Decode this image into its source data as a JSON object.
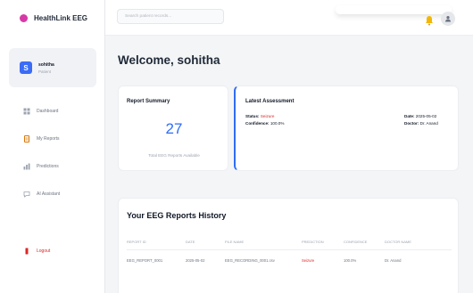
{
  "brand": {
    "name": "HealthLink EEG"
  },
  "user": {
    "initial": "S",
    "name": "sohitha",
    "role": "Patient"
  },
  "sidebar": {
    "items": [
      {
        "label": "Dashboard",
        "icon": "grid-icon"
      },
      {
        "label": "My Reports",
        "icon": "document-icon"
      },
      {
        "label": "Predictions",
        "icon": "chart-icon"
      },
      {
        "label": "AI Assistant",
        "icon": "chat-icon"
      }
    ],
    "logout_label": "Logout"
  },
  "topbar": {
    "search_placeholder": "Search patient records..."
  },
  "welcome": "Welcome, sohitha",
  "summary": {
    "title": "Report Summary",
    "count": "27",
    "subtitle": "Total EEG Reports Available"
  },
  "assessment": {
    "title": "Latest Assessment",
    "status_label": "Status:",
    "status_value": "Seizure",
    "confidence_label": "Confidence:",
    "confidence_value": "100.0%",
    "date_label": "Date:",
    "date_value": "2025-05-02",
    "doctor_label": "Doctor:",
    "doctor_value": "Dr. Anand"
  },
  "history": {
    "title": "Your EEG Reports History",
    "columns": [
      "REPORT ID",
      "DATE",
      "FILE NAME",
      "PREDICTION",
      "CONFIDENCE",
      "DOCTOR NAME"
    ],
    "rows": [
      [
        "EEG_REPORT_0001",
        "2025-05-02",
        "EEG_RECORDING_0001.csv",
        "Seizure",
        "100.0%",
        "Dr. Anand"
      ]
    ]
  },
  "colors": {
    "accent": "#2f6df6",
    "brand": "#d63aa5",
    "danger": "#dc2626"
  }
}
